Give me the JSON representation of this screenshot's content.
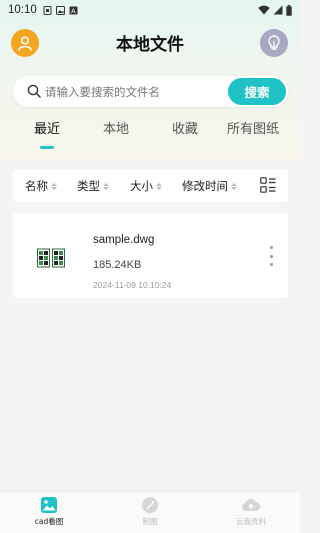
{
  "status_bar": {
    "time": "10:10"
  },
  "header": {
    "title": "本地文件"
  },
  "search": {
    "placeholder": "请输入要搜索的文件名",
    "button_label": "搜索"
  },
  "tabs": [
    {
      "label": "最近",
      "active": true
    },
    {
      "label": "本地",
      "active": false
    },
    {
      "label": "收藏",
      "active": false
    },
    {
      "label": "所有图纸",
      "active": false
    }
  ],
  "sort_bar": {
    "items": [
      "名称",
      "类型",
      "大小",
      "修改时间"
    ]
  },
  "files": [
    {
      "name": "sample.dwg",
      "size": "185.24KB",
      "modified": "2024-11-09 10:10:24"
    }
  ],
  "bottom_nav": [
    {
      "label": "cad看图",
      "active": true
    },
    {
      "label": "制图",
      "active": false
    },
    {
      "label": "云盘资料",
      "active": false
    }
  ],
  "colors": {
    "accent": "#1fc2c6",
    "avatar": "#f6a521",
    "bulb": "#a8a8c2"
  },
  "icons": [
    "user-icon",
    "lightbulb-icon",
    "search-icon",
    "list-view-icon",
    "dwg-file-icon",
    "more-vertical-icon",
    "image-icon",
    "pen-icon",
    "cloud-icon"
  ]
}
